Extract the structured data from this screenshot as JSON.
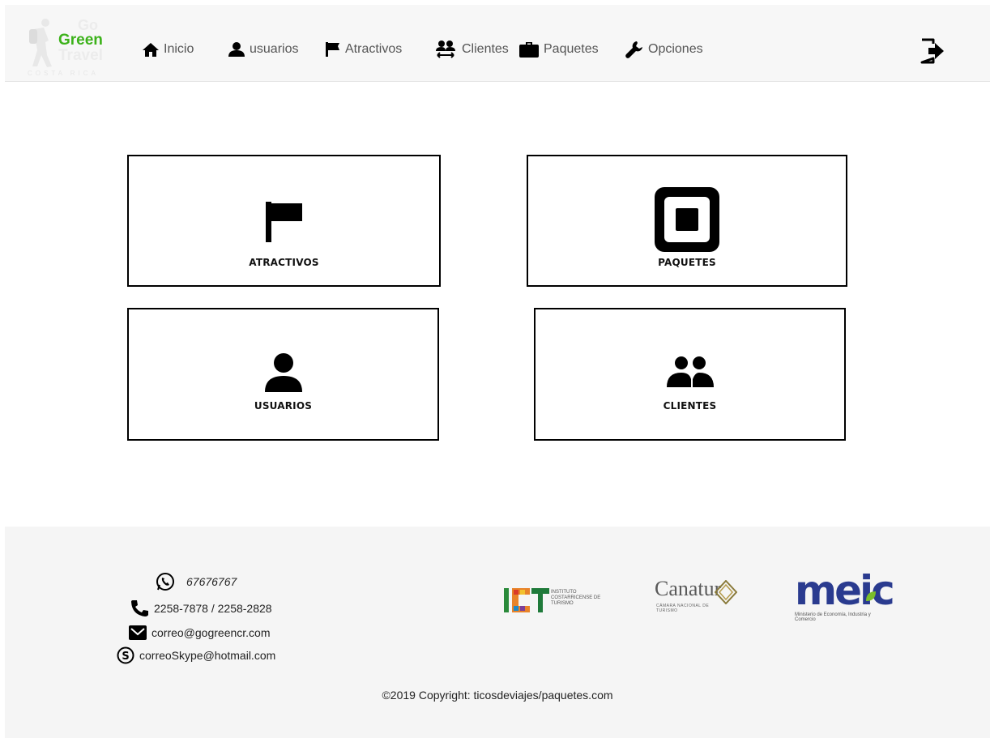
{
  "brand": {
    "go": "Go",
    "green": "Green",
    "travel": "Travel",
    "country": "COSTA RICA"
  },
  "nav": {
    "items": [
      {
        "label": "Inicio",
        "icon": "home-icon"
      },
      {
        "label": "usuarios",
        "icon": "user-icon"
      },
      {
        "label": "Atractivos",
        "icon": "flag-icon"
      },
      {
        "label": "Clientes",
        "icon": "people-arrows-icon"
      },
      {
        "label": "Paquetes",
        "icon": "briefcase-icon"
      },
      {
        "label": "Opciones",
        "icon": "wrench-icon"
      }
    ],
    "logout_icon": "sign-out-icon"
  },
  "cards": [
    {
      "label": "ATRACTIVOS",
      "icon": "flag-icon"
    },
    {
      "label": "PAQUETES",
      "icon": "square-icon"
    },
    {
      "label": "USUARIOS",
      "icon": "user-icon"
    },
    {
      "label": "CLIENTES",
      "icon": "users-icon"
    }
  ],
  "footer": {
    "whatsapp": "67676767",
    "phone": "2258-7878 / 2258-2828",
    "email": "correo@gogreencr.com",
    "skype": "correoSkype@hotmail.com",
    "copyright": "©2019 Copyright: ticosdeviajes/paquetes.com",
    "sponsors": {
      "ict": "INSTITUTO COSTARRICENSE DE TURISMO",
      "canatur": "Canatur",
      "canatur_sub": "CÁMARA NACIONAL DE TURISMO",
      "meic": "meic",
      "meic_sub": "Ministerio de Economía, Industria y Comercio"
    }
  },
  "colors": {
    "brand_green": "#3cb21a",
    "nav_bg": "#f7f7f7",
    "footer_bg": "#f5f5f5",
    "meic_blue": "#2a3b8f"
  }
}
